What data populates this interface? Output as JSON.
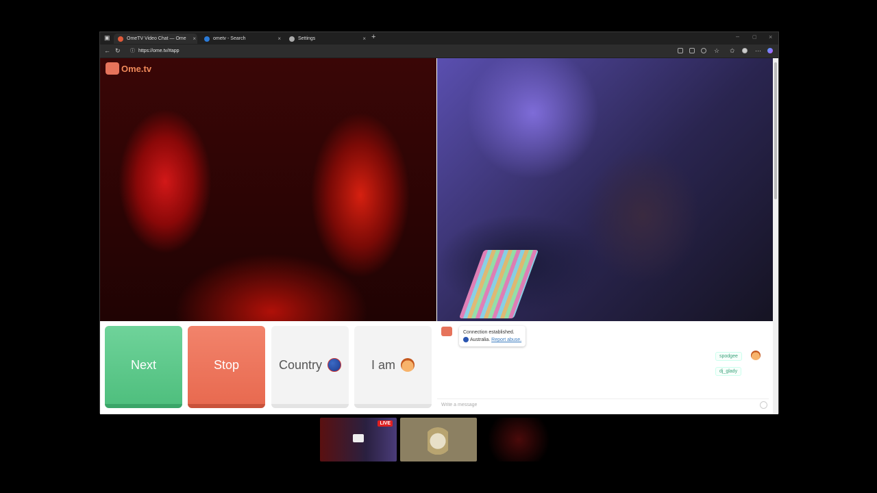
{
  "browser": {
    "tabs": [
      {
        "label": "OmeTV Video Chat — Ome",
        "favicon_color": "#e05a3a"
      },
      {
        "label": "ometv - Search",
        "favicon_color": "#2a7ad8"
      },
      {
        "label": "Settings",
        "favicon_color": "#aaaaaa"
      }
    ],
    "url": "https://ome.tv/#app"
  },
  "app": {
    "logo_text": "Ome.tv",
    "buttons": {
      "next": "Next",
      "stop": "Stop",
      "country": "Country",
      "iam": "I am"
    },
    "chat": {
      "system_line1": "Connection established.",
      "country": "Australia.",
      "report": "Report abuse.",
      "users": [
        "spodgee",
        "dj_glady"
      ],
      "placeholder": "Write a message"
    }
  },
  "thumbnails": {
    "live_badge": "LIVE"
  },
  "colors": {
    "next": "#4fbf7e",
    "stop": "#e86a50",
    "brand": "#e6735b"
  }
}
